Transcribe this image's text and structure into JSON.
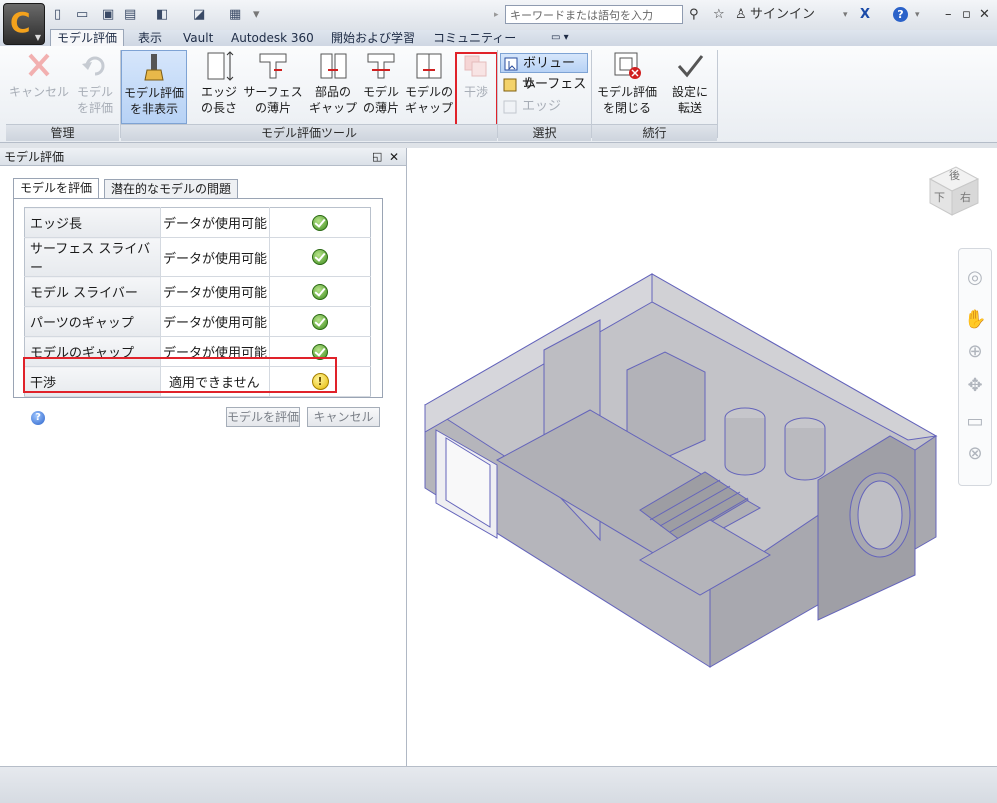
{
  "titlebar": {
    "search_placeholder": "キーワードまたは語句を入力",
    "signin": "サインイン",
    "help": "?"
  },
  "tabs": [
    "モデル評価",
    "表示",
    "Vault",
    "Autodesk 360",
    "開始および学習",
    "コミュニティー"
  ],
  "ribbon": {
    "manage": {
      "label": "管理",
      "cancel": [
        "キャンセル"
      ],
      "evaluate": [
        "モデル",
        "を評価"
      ]
    },
    "tools": {
      "label": "モデル評価ツール",
      "hide": [
        "モデル評価",
        "を非表示"
      ],
      "edge_length": [
        "エッジ",
        "の長さ"
      ],
      "surface_sliver": [
        "サーフェス",
        "の薄片"
      ],
      "part_gap": [
        "部品の",
        "ギャップ"
      ],
      "model_sliver": [
        "モデル",
        "の薄片"
      ],
      "model_gap": [
        "モデルの",
        "ギャップ"
      ],
      "interference": [
        "干渉"
      ]
    },
    "select": {
      "label": "選択",
      "volume": "ボリューム",
      "surface": "サーフェス",
      "edge": "エッジ"
    },
    "continue": {
      "label": "続行",
      "close": [
        "モデル評価",
        "を閉じる"
      ],
      "transfer": [
        "設定に",
        "転送"
      ]
    }
  },
  "panel": {
    "title": "モデル評価",
    "tabs": [
      "モデルを評価",
      "潜在的なモデルの問題"
    ],
    "rows": [
      {
        "name": "エッジ長",
        "status": "データが使用可能",
        "icon": "check-icon"
      },
      {
        "name": "サーフェス スライバー",
        "status": "データが使用可能",
        "icon": "check-icon"
      },
      {
        "name": "モデル スライバー",
        "status": "データが使用可能",
        "icon": "check-icon"
      },
      {
        "name": "パーツのギャップ",
        "status": "データが使用可能",
        "icon": "check-icon"
      },
      {
        "name": "モデルのギャップ",
        "status": "データが使用可能",
        "icon": "check-icon"
      },
      {
        "name": "干渉",
        "status": "適用できません",
        "icon": "warning-icon"
      }
    ],
    "evaluate_button": "モデルを評価",
    "cancel_button": "キャンセル"
  },
  "viewcube": {
    "top_face": "後",
    "front_face": "下",
    "right_face": "右"
  },
  "colors": {
    "highlight": "#e0222a",
    "accent": "#f4a21c"
  }
}
